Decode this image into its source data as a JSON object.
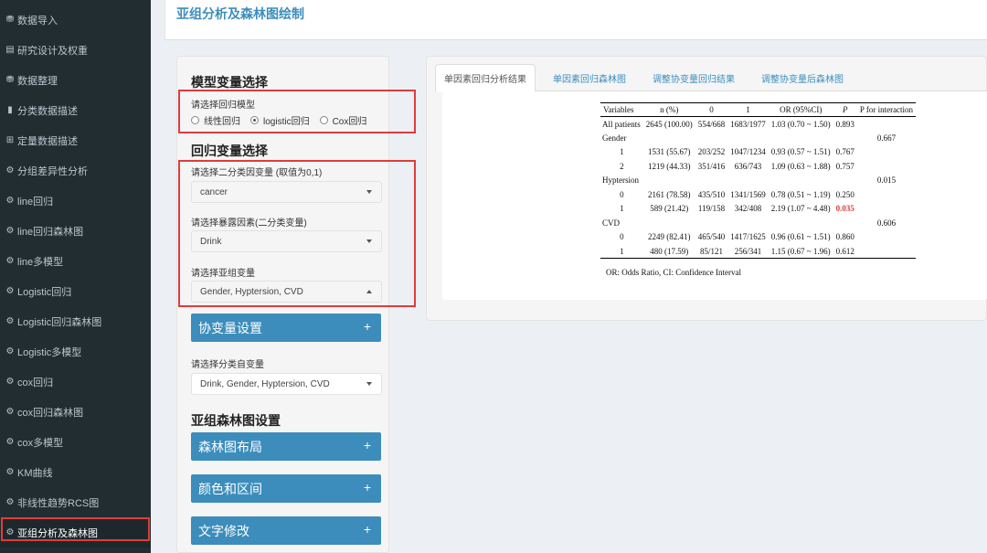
{
  "page": {
    "title": "亚组分析及森林图绘制"
  },
  "sidebar": {
    "items": [
      {
        "icon": "database-icon",
        "glyph": "⛃",
        "label": "数据导入"
      },
      {
        "icon": "table-icon",
        "glyph": "▤",
        "label": "研究设计及权重"
      },
      {
        "icon": "database-icon",
        "glyph": "⛃",
        "label": "数据整理"
      },
      {
        "icon": "bar-chart-icon",
        "glyph": "▮",
        "label": "分类数据描述"
      },
      {
        "icon": "grid-icon",
        "glyph": "⊞",
        "label": "定量数据描述"
      },
      {
        "icon": "gear-icon",
        "glyph": "⚙",
        "label": "分组差异性分析"
      },
      {
        "icon": "gear-icon",
        "glyph": "⚙",
        "label": "line回归"
      },
      {
        "icon": "gear-icon",
        "glyph": "⚙",
        "label": "line回归森林图"
      },
      {
        "icon": "gear-icon",
        "glyph": "⚙",
        "label": "line多模型"
      },
      {
        "icon": "gear-icon",
        "glyph": "⚙",
        "label": "Logistic回归"
      },
      {
        "icon": "gear-icon",
        "glyph": "⚙",
        "label": "Logistic回归森林图"
      },
      {
        "icon": "gear-icon",
        "glyph": "⚙",
        "label": "Logistic多模型"
      },
      {
        "icon": "gear-icon",
        "glyph": "⚙",
        "label": "cox回归"
      },
      {
        "icon": "gear-icon",
        "glyph": "⚙",
        "label": "cox回归森林图"
      },
      {
        "icon": "gear-icon",
        "glyph": "⚙",
        "label": "cox多模型"
      },
      {
        "icon": "gear-icon",
        "glyph": "⚙",
        "label": "KM曲线"
      },
      {
        "icon": "gear-icon",
        "glyph": "⚙",
        "label": "非线性趋势RCS图"
      },
      {
        "icon": "gear-icon",
        "glyph": "⚙",
        "label": "亚组分析及森林图"
      }
    ],
    "active_index": 17
  },
  "model_section": {
    "title": "模型变量选择",
    "model_label": "请选择回归模型",
    "options": [
      "线性回归",
      "logistic回归",
      "Cox回归"
    ],
    "selected": "logistic回归"
  },
  "reg_section": {
    "title": "回归变量选择",
    "outcome_label": "请选择二分类因变量 (取值为0,1)",
    "outcome_value": "cancer",
    "exposure_label": "请选择暴露因素(二分类变量)",
    "exposure_value": "Drink",
    "subgroup_label": "请选择亚组变量",
    "subgroup_value": "Gender, Hyptersion, CVD"
  },
  "covariate": {
    "button": "协变量设置",
    "cat_label": "请选择分类自变量",
    "cat_value": "Drink, Gender, Hyptersion, CVD"
  },
  "forest_section": {
    "title": "亚组森林图设置",
    "buttons": [
      "森林图布局",
      "颜色和区间",
      "文字修改"
    ]
  },
  "tabs": [
    "单因素回归分析结果",
    "单因素回归森林图",
    "调整协变量回归结果",
    "调整协变量后森林图"
  ],
  "active_tab": 0,
  "result_table": {
    "headers": [
      "Variables",
      "n (%)",
      "0",
      "1",
      "OR (95%CI)",
      "P",
      "P for interaction"
    ],
    "rows": [
      {
        "var": "All patients",
        "n": "2645 (100.00)",
        "c0": "554/668",
        "c1": "1683/1977",
        "or": "1.03 (0.70 ~ 1.50)",
        "p": "0.893",
        "pint": "",
        "indent": false
      },
      {
        "var": "Gender",
        "n": "",
        "c0": "",
        "c1": "",
        "or": "",
        "p": "",
        "pint": "0.667",
        "indent": false
      },
      {
        "var": "1",
        "n": "1531 (55.67)",
        "c0": "203/252",
        "c1": "1047/1234",
        "or": "0.93 (0.57 ~ 1.51)",
        "p": "0.767",
        "pint": "",
        "indent": true
      },
      {
        "var": "2",
        "n": "1219 (44.33)",
        "c0": "351/416",
        "c1": "636/743",
        "or": "1.09 (0.63 ~ 1.88)",
        "p": "0.757",
        "pint": "",
        "indent": true
      },
      {
        "var": "Hyptersion",
        "n": "",
        "c0": "",
        "c1": "",
        "or": "",
        "p": "",
        "pint": "0.015",
        "indent": false
      },
      {
        "var": "0",
        "n": "2161 (78.58)",
        "c0": "435/510",
        "c1": "1341/1569",
        "or": "0.78 (0.51 ~ 1.19)",
        "p": "0.250",
        "pint": "",
        "indent": true
      },
      {
        "var": "1",
        "n": "589 (21.42)",
        "c0": "119/158",
        "c1": "342/408",
        "or": "2.19 (1.07 ~ 4.48)",
        "p": "0.035",
        "pint": "",
        "indent": true,
        "sig": true
      },
      {
        "var": "CVD",
        "n": "",
        "c0": "",
        "c1": "",
        "or": "",
        "p": "",
        "pint": "0.606",
        "indent": false
      },
      {
        "var": "0",
        "n": "2249 (82.41)",
        "c0": "465/540",
        "c1": "1417/1625",
        "or": "0.96 (0.61 ~ 1.51)",
        "p": "0.860",
        "pint": "",
        "indent": true
      },
      {
        "var": "1",
        "n": "480 (17.59)",
        "c0": "85/121",
        "c1": "256/341",
        "or": "1.15 (0.67 ~ 1.96)",
        "p": "0.612",
        "pint": "",
        "indent": true
      }
    ],
    "note": "OR: Odds Ratio, CI: Confidence Interval"
  },
  "colors": {
    "sidebar_bg": "#222d32",
    "accent": "#3c8dbc",
    "highlight_border": "#e03c3c",
    "significant": "#e03c3c"
  }
}
